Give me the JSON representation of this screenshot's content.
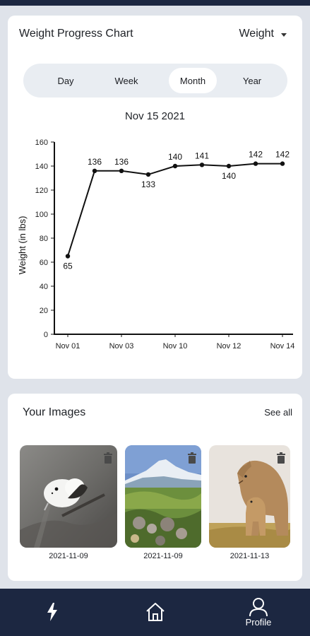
{
  "chart_card": {
    "title": "Weight Progress Chart",
    "metric_select": "Weight",
    "ranges": [
      {
        "label": "Day",
        "active": false
      },
      {
        "label": "Week",
        "active": false
      },
      {
        "label": "Month",
        "active": true
      },
      {
        "label": "Year",
        "active": false
      }
    ],
    "date_heading": "Nov 15 2021"
  },
  "chart_data": {
    "type": "line",
    "ylabel": "Weight (in lbs)",
    "ylim": [
      0,
      160
    ],
    "yticks": [
      0,
      20,
      40,
      60,
      80,
      100,
      120,
      140,
      160
    ],
    "xtick_labels": [
      "Nov 01",
      "Nov 03",
      "Nov 10",
      "Nov 12",
      "Nov 14"
    ],
    "grid": false,
    "series": [
      {
        "color": "#111111",
        "points": [
          {
            "x": 0,
            "y": 65
          },
          {
            "x": 1,
            "y": 136
          },
          {
            "x": 2,
            "y": 136
          },
          {
            "x": 3,
            "y": 133
          },
          {
            "x": 4,
            "y": 140
          },
          {
            "x": 5,
            "y": 141
          },
          {
            "x": 6,
            "y": 140
          },
          {
            "x": 7,
            "y": 142
          },
          {
            "x": 8,
            "y": 142
          }
        ]
      }
    ]
  },
  "images_card": {
    "title": "Your Images",
    "see_all": "See all",
    "images": [
      {
        "subject": "white bird on branch",
        "date": "2021-11-09"
      },
      {
        "subject": "mountain meadow",
        "date": "2021-11-09"
      },
      {
        "subject": "cougar with cub",
        "date": "2021-11-13"
      }
    ]
  },
  "bottom_nav": {
    "items": [
      {
        "icon": "lightning-icon",
        "label": ""
      },
      {
        "icon": "home-icon",
        "label": ""
      },
      {
        "icon": "profile-icon",
        "label": "Profile"
      }
    ]
  },
  "colors": {
    "nav_background": "#1c2741",
    "page_background": "#dfe3ea",
    "segment_background": "#e9edf2"
  }
}
